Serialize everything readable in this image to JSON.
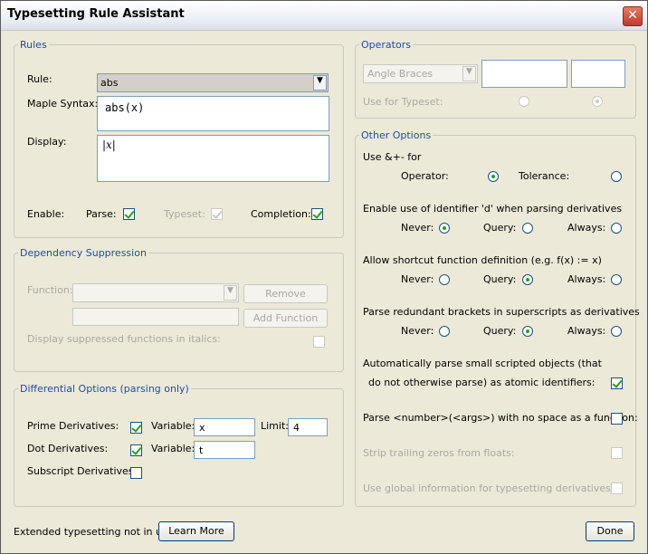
{
  "window": {
    "title": "Typesetting Rule Assistant"
  },
  "rules": {
    "legend": "Rules",
    "rule_label": "Rule:",
    "rule_value": "abs",
    "maple_syntax_label": "Maple Syntax:",
    "maple_syntax_value": "abs(x)",
    "display_label": "Display:",
    "display_value": "|x|",
    "enable_label": "Enable:",
    "parse_label": "Parse:",
    "typeset_label": "Typeset:",
    "completion_label": "Completion:"
  },
  "dependency": {
    "legend": "Dependency Suppression",
    "function_label": "Function:",
    "remove_label": "Remove",
    "add_function_label": "Add Function",
    "italics_label": "Display suppressed functions in italics:"
  },
  "differential": {
    "legend": "Differential Options (parsing only)",
    "prime_label": "Prime Derivatives:",
    "variable_label": "Variable:",
    "prime_variable": "x",
    "limit_label": "Limit:",
    "limit_value": "4",
    "dot_label": "Dot Derivatives:",
    "dot_variable": "t",
    "subscript_label": "Subscript Derivatives:"
  },
  "operators": {
    "legend": "Operators",
    "combo_value": "Angle Braces",
    "use_for_typeset_label": "Use for Typeset:"
  },
  "other": {
    "legend": "Other Options",
    "use_amp_label": "Use &+- for",
    "operator_label": "Operator:",
    "tolerance_label": "Tolerance:",
    "identifier_d_label": "Enable use of identifier 'd' when parsing derivatives",
    "never_label": "Never:",
    "query_label": "Query:",
    "always_label": "Always:",
    "shortcut_label": "Allow shortcut function definition (e.g. f(x) := x)",
    "redundant_label": "Parse redundant brackets in superscripts as derivatives",
    "auto_parse_line1": "Automatically parse small scripted objects (that",
    "auto_parse_line2": "do not otherwise parse) as atomic identifiers:",
    "number_args_label": "Parse <number>(<args>) with no space as a function:",
    "strip_zeros_label": "Strip trailing zeros from floats:",
    "global_info_label": "Use global information for typesetting derivatives:"
  },
  "footer": {
    "status_text": "Extended typesetting not in use",
    "learn_more_label": "Learn More",
    "done_label": "Done"
  }
}
